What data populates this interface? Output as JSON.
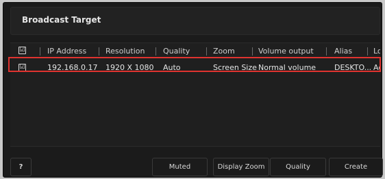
{
  "panel": {
    "title": "Broadcast Target"
  },
  "table": {
    "header_checkbox": "☑",
    "columns": [
      "IP Address",
      "Resolution",
      "Quality",
      "Zoom",
      "Volume output",
      "Alias",
      "Lo"
    ],
    "rows": [
      {
        "checkbox": "☑",
        "ip": "192.168.0.17",
        "resolution": "1920 X 1080",
        "quality": "Auto",
        "zoom": "Screen Size",
        "volume": "Normal volume",
        "alias": "DESKTO...",
        "location": "Ac"
      }
    ]
  },
  "footer": {
    "help": "?",
    "muted": "Muted",
    "display_zoom": "Display Zoom",
    "quality": "Quality",
    "create": "Create"
  },
  "colors": {
    "selection_outline": "#e0332f",
    "panel_bg": "#1b1b1b",
    "page_bg": "#c9c9c9"
  }
}
